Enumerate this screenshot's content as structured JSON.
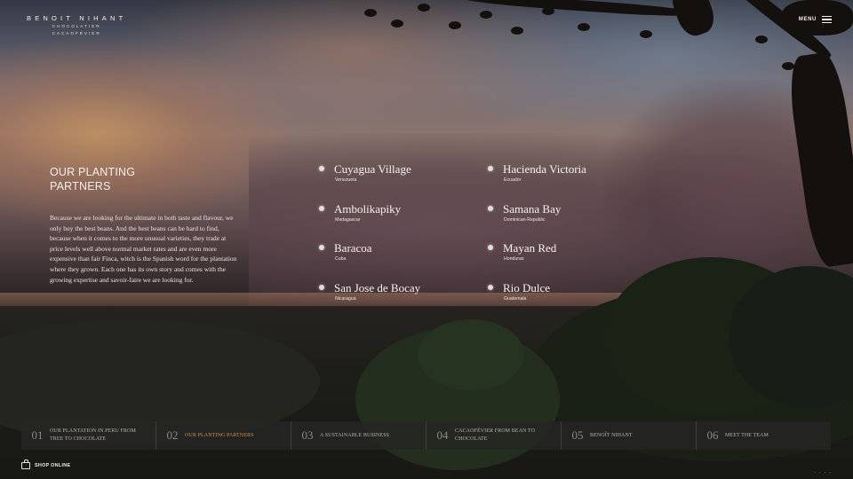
{
  "header": {
    "logo_name": "BENOIT NIHANT",
    "logo_line1": "CHOCOLATIER",
    "logo_line2": "CACAOFÉVIER",
    "menu_label": "MENU"
  },
  "intro": {
    "title_line1": "OUR PLANTING",
    "title_line2": "PARTNERS",
    "body": "Because we are looking for the ultimate in both taste and flavour, we only buy the best beans. And the best beans can be hard to find, because when it comes to the more unusual varieties, they trade at price levels well above normal market rates and are even more expensive than fair Finca, witch is the Spanish word for the plantation where they grown. Each one has its own story and comes with the growing expertise and savoir-faire we are looking for."
  },
  "partners": [
    {
      "name": "Cuyagua Village",
      "country": "Venezuela"
    },
    {
      "name": "Hacienda Victoria",
      "country": "Ecuador"
    },
    {
      "name": "Ambolikapiky",
      "country": "Madagascar"
    },
    {
      "name": "Samana Bay",
      "country": "Dominican-Republic"
    },
    {
      "name": "Baracoa",
      "country": "Cuba"
    },
    {
      "name": "Mayan Red",
      "country": "Honduras"
    },
    {
      "name": "San Jose de Bocay",
      "country": "Nicaragua"
    },
    {
      "name": "Rio Dulce",
      "country": "Guatemala"
    }
  ],
  "nav": [
    {
      "num": "01",
      "label": "OUR PLANTATION IN PERU FROM TREE TO CHOCOLATE",
      "active": false
    },
    {
      "num": "02",
      "label": "OUR PLANTING PARTNERS",
      "active": true
    },
    {
      "num": "03",
      "label": "A SUSTAINABLE BUSINESS",
      "active": false
    },
    {
      "num": "04",
      "label": "CACAOFÉVIER FROM BEAN TO CHOCOLATE",
      "active": false
    },
    {
      "num": "05",
      "label": "BENOÎT NIHANT",
      "active": false
    },
    {
      "num": "06",
      "label": "MEET THE TEAM",
      "active": false
    }
  ],
  "footer": {
    "shop_label": "SHOP ONLINE",
    "corner": "· · · ·"
  },
  "colors": {
    "accent": "#d48a52",
    "nav_bg": "#262624",
    "text": "#f2ece6"
  },
  "icons": {
    "menu": "hamburger-icon",
    "shop": "shopping-bag-icon",
    "partner_marker": "dot-icon"
  }
}
